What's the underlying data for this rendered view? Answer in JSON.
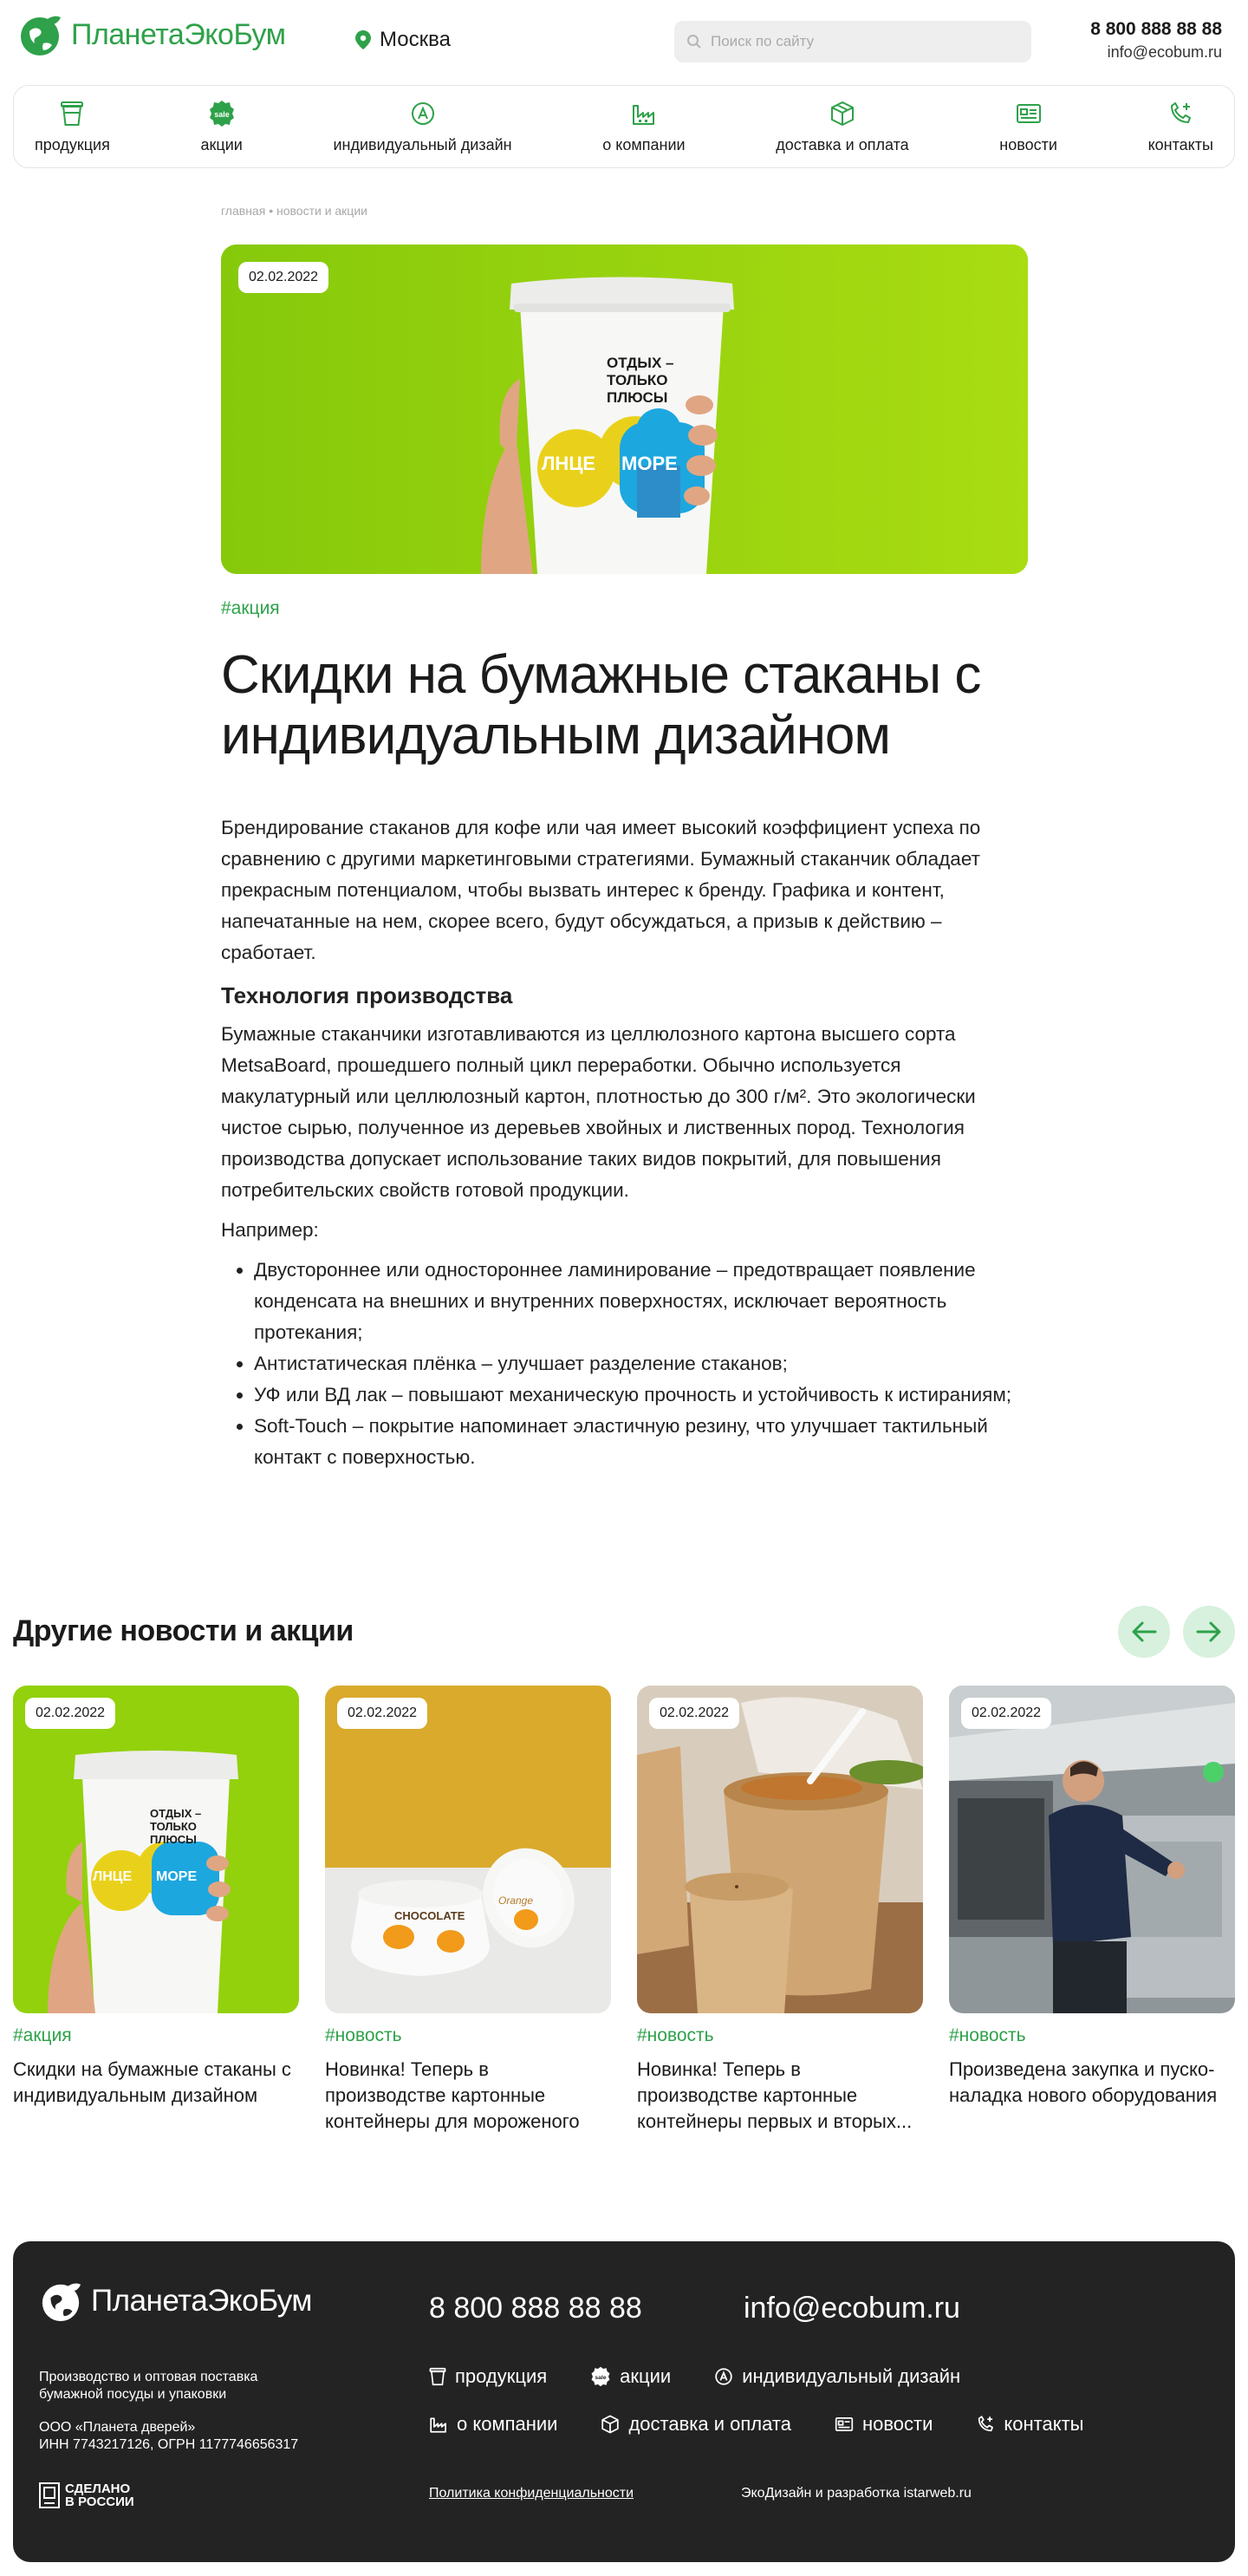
{
  "header": {
    "brand": "ПланетаЭкоБум",
    "city": "Москва",
    "search_placeholder": "Поиск по сайту",
    "phone": "8 800 888 88 88",
    "email": "info@ecobum.ru"
  },
  "nav": [
    {
      "label": "продукция",
      "icon": "cup-icon"
    },
    {
      "label": "акции",
      "icon": "sale-icon"
    },
    {
      "label": "индивидуальный дизайн",
      "icon": "design-icon"
    },
    {
      "label": "о компании",
      "icon": "factory-icon"
    },
    {
      "label": "доставка и оплата",
      "icon": "box-icon"
    },
    {
      "label": "новости",
      "icon": "newspaper-icon"
    },
    {
      "label": "контакты",
      "icon": "phone-icon"
    }
  ],
  "breadcrumb": {
    "home": "главная",
    "separator": "•",
    "current": "новости и акции"
  },
  "article": {
    "date": "02.02.2022",
    "tag": "#акция",
    "title": "Скидки на бумажные стаканы с индивидуальным дизайном",
    "cup_text": [
      "ОТДЫХ –",
      "ТОЛЬКО",
      "ПЛЮСЫ"
    ],
    "cup_words": {
      "left": "ЛНЦЕ",
      "right": "МОРЕ"
    },
    "intro": "Брендирование стаканов для кофе или чая имеет высокий коэффициент успеха по сравнению с другими маркетинговыми стратегиями. Бумажный стаканчик обладает прекрасным потенциалом, чтобы вызвать интерес к бренду. Графика и контент, напечатанные на нем, скорее всего, будут обсуждаться, а призыв к действию – сработает.",
    "subtitle": "Технология производства",
    "tech": "Бумажные стаканчики изготавливаются из целлюлозного картона высшего сорта MetsaBoard, прошедшего полный цикл переработки. Обычно используется макулатурный или целлюлозный картон, плотностью до 300 г/м². Это экологически чистое сырью, полученное из деревьев хвойных и лиственных пород. Технология производства допускает использование таких видов покрытий, для повышения потребительских свойств готовой продукции.",
    "example_label": "Например:",
    "list": [
      "Двустороннее или одностороннее ламинирование – предотвращает появление конденсата на внешних и внутренних поверхностях, исключает вероятность протекания;",
      "Антистатическая плёнка – улучшает разделение стаканов;",
      "УФ или ВД лак – повышают механическую прочность и устойчивость к истираниям;",
      "Soft-Touch – покрытие напоминает эластичную резину, что улучшает тактильный контакт с поверхностью."
    ]
  },
  "others": {
    "title": "Другие новости и акции",
    "cards": [
      {
        "date": "02.02.2022",
        "tag": "#акция",
        "title": "Скидки на бумажные стаканы с индивидуальным дизайном"
      },
      {
        "date": "02.02.2022",
        "tag": "#новость",
        "title": "Новинка! Теперь в производстве картонные контейнеры для мороженого",
        "box_label": "CHOCOLATE",
        "box_sub": "Orange"
      },
      {
        "date": "02.02.2022",
        "tag": "#новость",
        "title": "Новинка! Теперь в производстве картонные контейнеры первых и вторых..."
      },
      {
        "date": "02.02.2022",
        "tag": "#новость",
        "title": "Произведена закупка и пуско-наладка нового оборудования"
      }
    ]
  },
  "footer": {
    "brand": "ПланетаЭкоБум",
    "phone": "8 800 888 88 88",
    "email": "info@ecobum.ru",
    "description": "Производство и оптовая поставка бумажной посуды и упаковки",
    "company": "ООО «Планета дверей»",
    "ids": "ИНН 7743217126, ОГРН 1177746656317",
    "made_line1": "СДЕЛАНО",
    "made_line2": "В РОССИИ",
    "nav_row1": [
      {
        "label": "продукция",
        "icon": "cup-icon"
      },
      {
        "label": "акции",
        "icon": "sale-icon"
      },
      {
        "label": "индивидуальный дизайн",
        "icon": "design-icon"
      }
    ],
    "nav_row2": [
      {
        "label": "о компании",
        "icon": "factory-icon"
      },
      {
        "label": "доставка и оплата",
        "icon": "box-icon"
      },
      {
        "label": "новости",
        "icon": "newspaper-icon"
      },
      {
        "label": "контакты",
        "icon": "phone-icon"
      }
    ],
    "policy": "Политика конфиденциальности",
    "developer": "ЭкоДизайн и разработка istarweb.ru"
  },
  "colors": {
    "accent": "#2ea14a",
    "accent_light": "#d7f1de",
    "footer_bg": "#232323",
    "hero_bg": "#8fcf0a"
  }
}
